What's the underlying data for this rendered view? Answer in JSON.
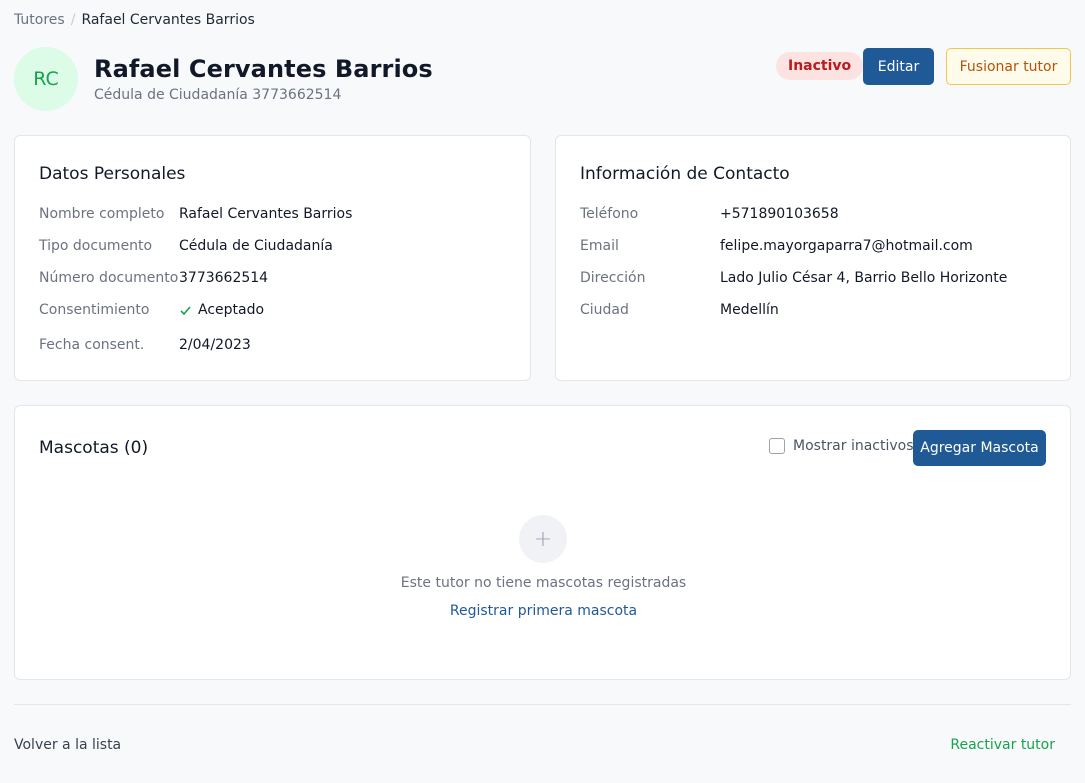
{
  "breadcrumb": {
    "root": "Tutores",
    "separator": "/",
    "current": "Rafael Cervantes Barrios"
  },
  "header": {
    "initials": "RC",
    "name": "Rafael Cervantes Barrios",
    "document": "Cédula de Ciudadanía 3773662514",
    "status": "Inactivo",
    "edit_label": "Editar",
    "merge_label": "Fusionar tutor"
  },
  "personal": {
    "title": "Datos Personales",
    "rows": [
      {
        "label": "Nombre completo",
        "value": "Rafael Cervantes Barrios"
      },
      {
        "label": "Tipo documento",
        "value": "Cédula de Ciudadanía"
      },
      {
        "label": "Número documento",
        "value": "3773662514"
      },
      {
        "label": "Consentimiento",
        "value": "Aceptado"
      },
      {
        "label": "Fecha consent.",
        "value": "2/04/2023"
      }
    ]
  },
  "contact": {
    "title": "Información de Contacto",
    "rows": [
      {
        "label": "Teléfono",
        "value": "+571890103658"
      },
      {
        "label": "Email",
        "value": "felipe.mayorgaparra7@hotmail.com"
      },
      {
        "label": "Dirección",
        "value": "Lado Julio César 4, Barrio Bello Horizonte"
      },
      {
        "label": "Ciudad",
        "value": "Medellín"
      }
    ]
  },
  "pets": {
    "title": "Mascotas (0)",
    "show_inactive_label": "Mostrar inactivos",
    "show_inactive_checked": false,
    "add_label": "Agregar Mascota",
    "empty_icon": "plus-icon",
    "empty_text": "Este tutor no tiene mascotas registradas",
    "empty_link": "Registrar primera mascota"
  },
  "footer": {
    "back_label": "Volver a la lista",
    "reactivate_label": "Reactivar tutor"
  },
  "colors": {
    "primary": "#1f5a96",
    "success": "#16a34a",
    "danger": "#b91c1c",
    "warning": "#b45309"
  }
}
